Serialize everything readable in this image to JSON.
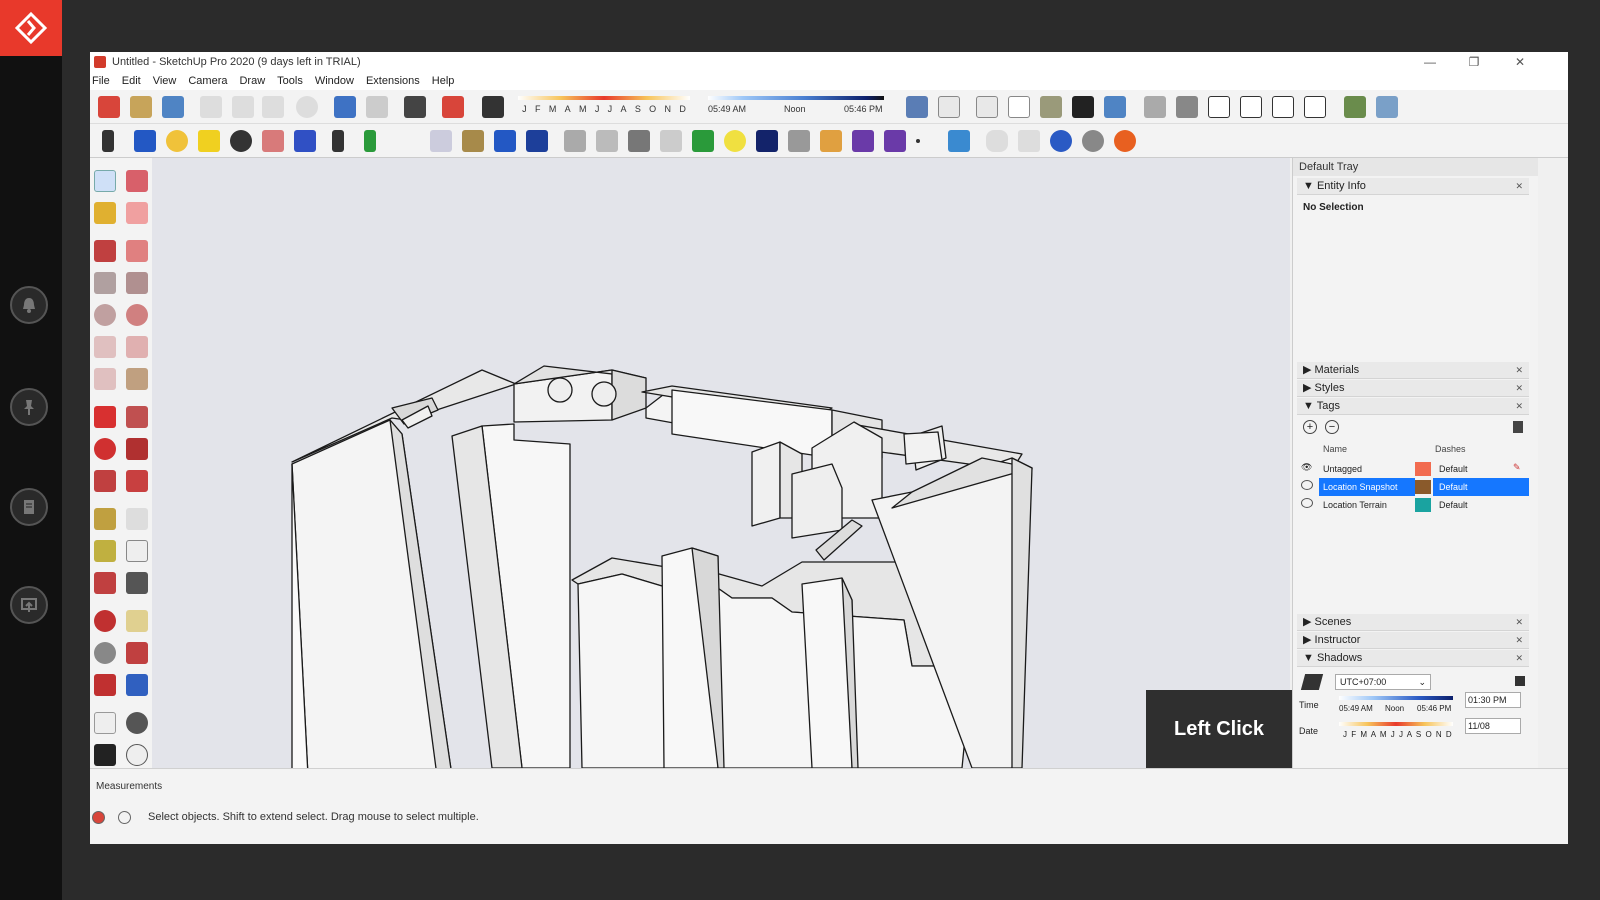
{
  "window": {
    "title": "Untitled - SketchUp Pro 2020 (9 days left in TRIAL)",
    "minimize": "—",
    "restore": "❐",
    "close": "✕"
  },
  "menu": [
    "File",
    "Edit",
    "View",
    "Camera",
    "Draw",
    "Tools",
    "Window",
    "Extensions",
    "Help"
  ],
  "shadow_toolbar": {
    "months": [
      "J",
      "F",
      "M",
      "A",
      "M",
      "J",
      "J",
      "A",
      "S",
      "O",
      "N",
      "D"
    ],
    "sunrise": "05:49 AM",
    "noon": "Noon",
    "sunset": "05:46 PM"
  },
  "overlay": {
    "left_click": "Left Click"
  },
  "tray": {
    "title": "Default Tray",
    "entity_info": {
      "label": "Entity Info",
      "selection": "No Selection"
    },
    "materials": "Materials",
    "styles": "Styles",
    "tags": {
      "label": "Tags",
      "col_name": "Name",
      "col_dashes": "Dashes",
      "rows": [
        {
          "name": "Untagged",
          "dashes": "Default",
          "color": "#f26b4f",
          "selected": false
        },
        {
          "name": "Location Snapshot",
          "dashes": "Default",
          "color": "#8a5a2b",
          "selected": true
        },
        {
          "name": "Location Terrain",
          "dashes": "Default",
          "color": "#1aa3a0",
          "selected": false
        }
      ]
    },
    "scenes": "Scenes",
    "instructor": "Instructor",
    "shadows": {
      "label": "Shadows",
      "timezone": "UTC+07:00",
      "time_label": "Time",
      "date_label": "Date",
      "time_sunrise": "05:49 AM",
      "time_noon": "Noon",
      "time_sunset": "05:46 PM",
      "time_value": "01:30 PM",
      "date_value": "11/08",
      "months": "J F M A M J J A S O N D"
    }
  },
  "status": {
    "measurements": "Measurements",
    "message": "Select objects. Shift to extend select. Drag mouse to select multiple."
  },
  "colors": {
    "accent": "#e8392b",
    "selection": "#1577ff"
  }
}
